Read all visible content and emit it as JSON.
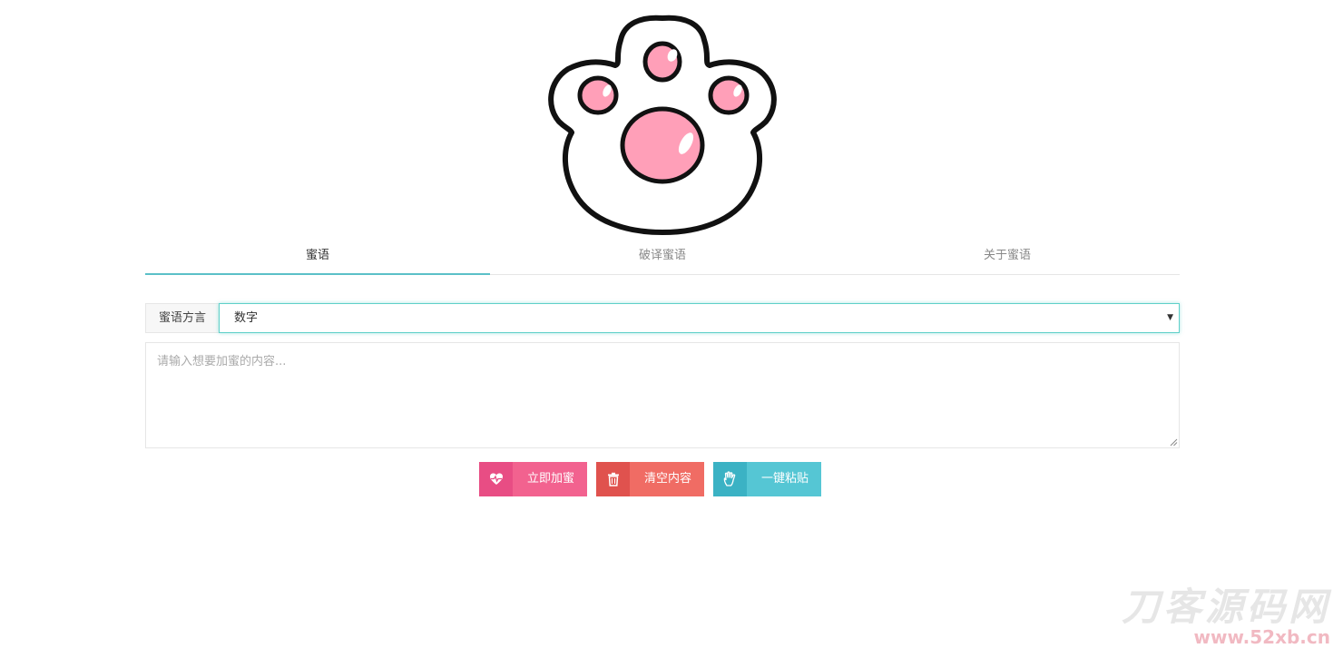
{
  "tabs": [
    {
      "label": "蜜语",
      "active": true
    },
    {
      "label": "破译蜜语",
      "active": false
    },
    {
      "label": "关于蜜语",
      "active": false
    }
  ],
  "form": {
    "dialect_label": "蜜语方言",
    "dialect_selected": "数字",
    "content_placeholder": "请输入想要加蜜的内容..."
  },
  "buttons": {
    "encrypt": "立即加蜜",
    "clear": "清空内容",
    "paste": "一键粘贴"
  },
  "colors": {
    "accent": "#5bc0c8",
    "encrypt": "#f2628f",
    "clear": "#f06c64",
    "paste": "#55c6d4",
    "paw_pad": "#ff9fb8"
  },
  "watermark": {
    "title": "刀客源码网",
    "url": "www.52xb.cn"
  },
  "icons": {
    "logo": "cat-paw-logo",
    "encrypt": "heart-pulse-icon",
    "clear": "trash-icon",
    "paste": "hand-icon"
  }
}
